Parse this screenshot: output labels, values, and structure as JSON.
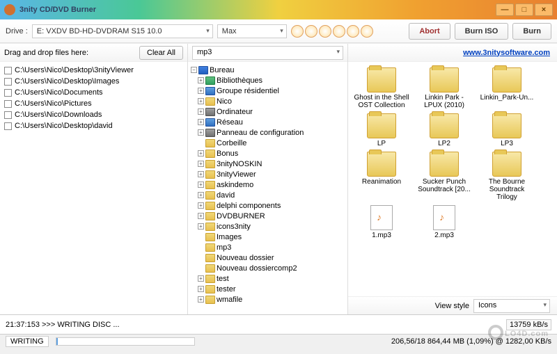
{
  "window": {
    "title": "3nity CD/DVD Burner",
    "min": "—",
    "max": "□",
    "close": "×"
  },
  "toolbar": {
    "drive_label": "Drive :",
    "drive_value": "E: VXDV    BD-HD-DVDRAM S15 10.0",
    "speed_value": "Max",
    "abort": "Abort",
    "burn_iso": "Burn ISO",
    "burn": "Burn"
  },
  "left": {
    "header": "Drag and drop files here:",
    "clear_all": "Clear All",
    "items": [
      "C:\\Users\\Nico\\Desktop\\3nityViewer",
      "C:\\Users\\Nico\\Desktop\\Images",
      "C:\\Users\\Nico\\Documents",
      "C:\\Users\\Nico\\Pictures",
      "C:\\Users\\Nico\\Downloads",
      "C:\\Users\\Nico\\Desktop\\david"
    ]
  },
  "mid": {
    "path_value": "mp3",
    "tree": [
      {
        "depth": 0,
        "exp": "minus",
        "icon": "desktop",
        "label": "Bureau"
      },
      {
        "depth": 1,
        "exp": "plus",
        "icon": "lib",
        "label": "Bibliothèques"
      },
      {
        "depth": 1,
        "exp": "plus",
        "icon": "net",
        "label": "Groupe résidentiel"
      },
      {
        "depth": 1,
        "exp": "plus",
        "icon": "folder",
        "label": "Nico"
      },
      {
        "depth": 1,
        "exp": "plus",
        "icon": "pc",
        "label": "Ordinateur"
      },
      {
        "depth": 1,
        "exp": "plus",
        "icon": "net",
        "label": "Réseau"
      },
      {
        "depth": 1,
        "exp": "plus",
        "icon": "pc",
        "label": "Panneau de configuration"
      },
      {
        "depth": 1,
        "exp": "none",
        "icon": "folder",
        "label": "Corbeille"
      },
      {
        "depth": 1,
        "exp": "plus",
        "icon": "folder",
        "label": "Bonus"
      },
      {
        "depth": 1,
        "exp": "plus",
        "icon": "folder",
        "label": "3nityNOSKIN"
      },
      {
        "depth": 1,
        "exp": "plus",
        "icon": "folder",
        "label": "3nityViewer"
      },
      {
        "depth": 1,
        "exp": "plus",
        "icon": "folder",
        "label": "askindemo"
      },
      {
        "depth": 1,
        "exp": "plus",
        "icon": "folder",
        "label": "david"
      },
      {
        "depth": 1,
        "exp": "plus",
        "icon": "folder",
        "label": "delphi components"
      },
      {
        "depth": 1,
        "exp": "plus",
        "icon": "folder",
        "label": "DVDBURNER"
      },
      {
        "depth": 1,
        "exp": "plus",
        "icon": "folder",
        "label": "icons3nity"
      },
      {
        "depth": 1,
        "exp": "none",
        "icon": "folder",
        "label": "Images"
      },
      {
        "depth": 1,
        "exp": "none",
        "icon": "folder",
        "label": "mp3"
      },
      {
        "depth": 1,
        "exp": "none",
        "icon": "folder",
        "label": "Nouveau dossier"
      },
      {
        "depth": 1,
        "exp": "none",
        "icon": "folder",
        "label": "Nouveau dossiercomp2"
      },
      {
        "depth": 1,
        "exp": "plus",
        "icon": "folder",
        "label": "test"
      },
      {
        "depth": 1,
        "exp": "plus",
        "icon": "folder",
        "label": "tester"
      },
      {
        "depth": 1,
        "exp": "plus",
        "icon": "folder",
        "label": "wmafile"
      }
    ]
  },
  "right": {
    "link": "www.3nitysoftware.com",
    "items": [
      {
        "type": "folder",
        "label": "Ghost in the Shell OST Collection"
      },
      {
        "type": "folder",
        "label": "Linkin Park - LPUX (2010)"
      },
      {
        "type": "folder",
        "label": "Linkin_Park-Un..."
      },
      {
        "type": "folder",
        "label": "LP"
      },
      {
        "type": "folder",
        "label": "LP2"
      },
      {
        "type": "folder",
        "label": "LP3"
      },
      {
        "type": "folder",
        "label": "Reanimation"
      },
      {
        "type": "folder",
        "label": "Sucker Punch Soundtrack [20..."
      },
      {
        "type": "folder",
        "label": "The Bourne Soundtrack Trilogy"
      },
      {
        "type": "file",
        "label": "1.mp3"
      },
      {
        "type": "file",
        "label": "2.mp3"
      }
    ],
    "view_style_label": "View style",
    "view_style_value": "Icons"
  },
  "status": {
    "log": "21:37:153 >>> WRITING DISC ...",
    "speed": "13759 kB/s",
    "state": "WRITING",
    "progress": "206,56/18 864,44 MB (1,09%) @ 1282,00 KB/s"
  },
  "watermark": "LO4D.com"
}
